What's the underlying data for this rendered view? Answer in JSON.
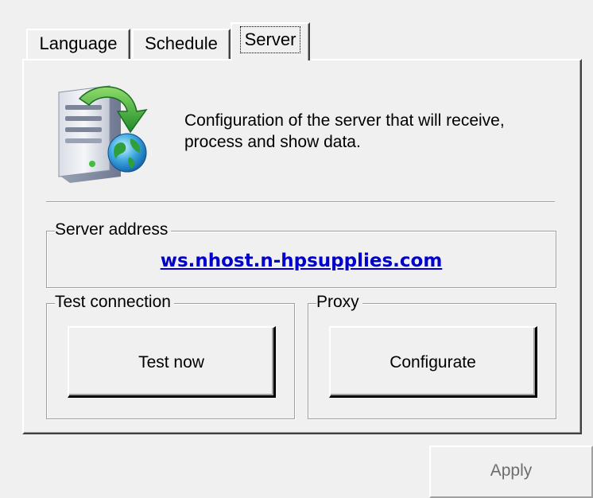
{
  "tabs": [
    {
      "label": "Language",
      "selected": false
    },
    {
      "label": "Schedule",
      "selected": false
    },
    {
      "label": "Server",
      "selected": true
    }
  ],
  "server_panel": {
    "icon": "server-download-globe-icon",
    "description_line1": "Configuration of the server that will receive,",
    "description_line2": "process and show data.",
    "address_group": {
      "legend": "Server address",
      "address": "ws.nhost.n-hpsupplies.com"
    },
    "test_group": {
      "legend": "Test connection",
      "button_label": "Test now"
    },
    "proxy_group": {
      "legend": "Proxy",
      "button_label": "Configurate"
    }
  },
  "footer": {
    "apply_label": "Apply",
    "apply_enabled": false
  },
  "colors": {
    "window_bg": "#f0f0f0",
    "link": "#0000cc",
    "disabled_text": "#6d6d6d"
  }
}
